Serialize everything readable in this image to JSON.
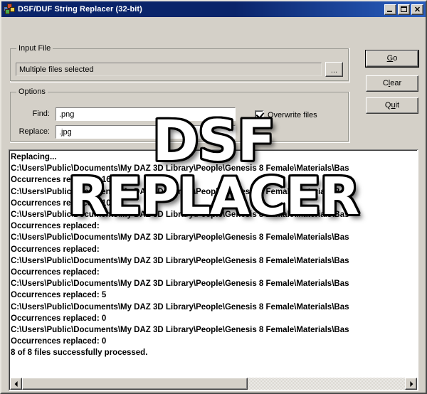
{
  "window": {
    "title": "DSF/DUF String Replacer (32-bit)",
    "icon": "app-blocks-icon",
    "controls": {
      "minimize": "minimize-icon",
      "maximize": "maximize-icon",
      "close": "✕"
    }
  },
  "input_file": {
    "group_label": "Input File",
    "value": "Multiple files selected",
    "placeholder": "",
    "browse_label": "..."
  },
  "options": {
    "group_label": "Options",
    "find_label": "Find:",
    "find_value": ".png",
    "replace_label": "Replace:",
    "replace_value": ".jpg",
    "overwrite_label": "Overwrite files",
    "overwrite_checked": true
  },
  "buttons": {
    "go": {
      "accel": "G",
      "rest": "o"
    },
    "clear": {
      "pre": "C",
      "accel": "l",
      "rest": "ear"
    },
    "quit": {
      "pre": "Q",
      "accel": "u",
      "rest": "it"
    }
  },
  "log": {
    "lines": [
      "Replacing...",
      "C:\\Users\\Public\\Documents\\My DAZ 3D Library\\People\\Genesis 8 Female\\Materials\\Bas",
      "Occurrences replaced: 163",
      "C:\\Users\\Public\\Documents\\My DAZ 3D Library\\People\\Genesis 8 Female\\Materials\\Bas",
      "Occurrences replaced: 10",
      "C:\\Users\\Public\\Documents\\My DAZ 3D Library\\People\\Genesis 8 Female\\Materials\\Bas",
      "Occurrences replaced:",
      "C:\\Users\\Public\\Documents\\My DAZ 3D Library\\People\\Genesis 8 Female\\Materials\\Bas",
      "Occurrences replaced:",
      "C:\\Users\\Public\\Documents\\My DAZ 3D Library\\People\\Genesis 8 Female\\Materials\\Bas",
      "Occurrences replaced:",
      "C:\\Users\\Public\\Documents\\My DAZ 3D Library\\People\\Genesis 8 Female\\Materials\\Bas",
      "Occurrences replaced: 5",
      "C:\\Users\\Public\\Documents\\My DAZ 3D Library\\People\\Genesis 8 Female\\Materials\\Bas",
      "Occurrences replaced: 0",
      "C:\\Users\\Public\\Documents\\My DAZ 3D Library\\People\\Genesis 8 Female\\Materials\\Bas",
      "Occurrences replaced: 0",
      "8 of 8 files successfully processed."
    ]
  },
  "watermark": {
    "line1": "DSF",
    "line2": "REPLACER"
  },
  "colors": {
    "titlebar": "#0a246a",
    "face": "#d4d0c8",
    "field": "#ffffff",
    "text": "#000000"
  }
}
